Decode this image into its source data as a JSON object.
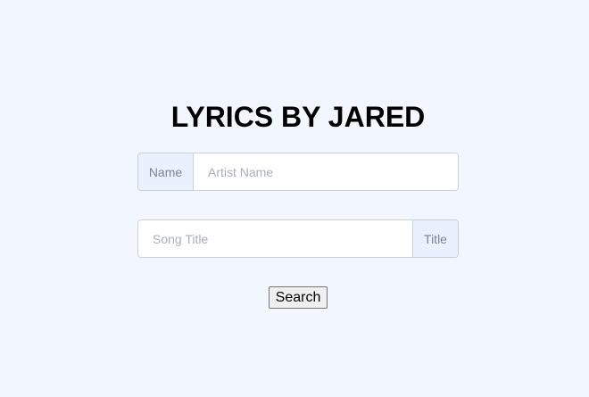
{
  "header": {
    "title": "LYRICS BY JARED"
  },
  "artist_field": {
    "addon_label": "Name",
    "placeholder": "Artist Name",
    "value": ""
  },
  "song_field": {
    "addon_label": "Title",
    "placeholder": "Song Title",
    "value": ""
  },
  "actions": {
    "search_label": "Search"
  }
}
